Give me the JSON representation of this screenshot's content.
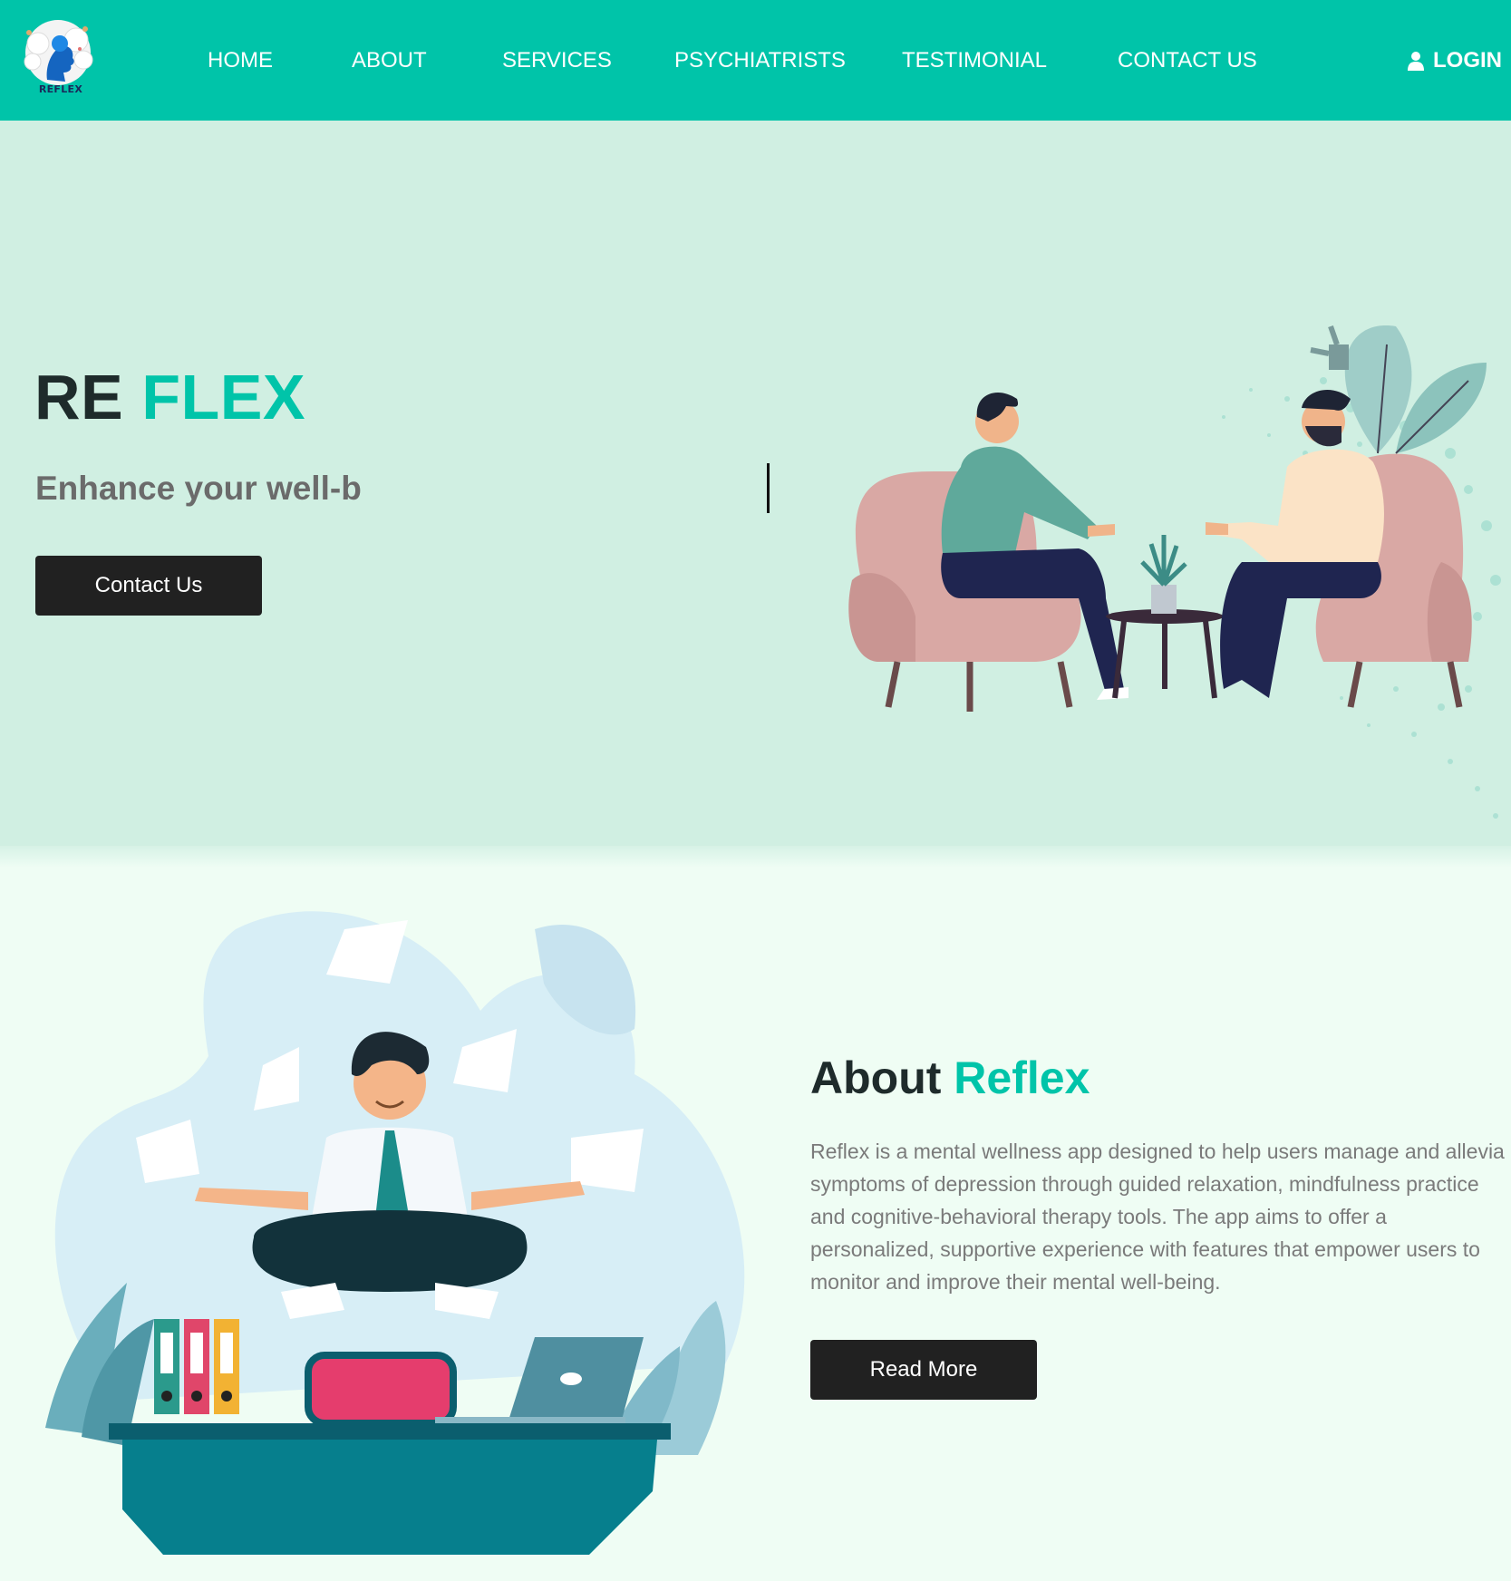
{
  "brand": {
    "logo_text": "REFLEX"
  },
  "nav": {
    "items": [
      "HOME",
      "ABOUT",
      "SERVICES",
      "PSYCHIATRISTS",
      "TESTIMONIAL",
      "CONTACT US"
    ],
    "login_label": "LOGIN",
    "login_icon": "user-icon"
  },
  "hero": {
    "title_part1": "RE",
    "title_part2": "FLEX",
    "subtitle": "Enhance your well-b",
    "button_label": "Contact Us",
    "illustration": "therapy-session-illustration"
  },
  "about": {
    "title_part1": "About",
    "title_part2": "Reflex",
    "body": "Reflex is a mental wellness app designed to help users manage and allevia\nsymptoms of depression through guided relaxation, mindfulness practice\nand cognitive-behavioral therapy tools. The app aims to offer a\npersonalized, supportive experience with features that empower users to\nmonitor and improve their mental well-being.",
    "button_label": "Read More",
    "illustration": "meditation-illustration"
  },
  "colors": {
    "accent": "#00c4a9",
    "hero_bg": "#d0efe2",
    "page_bg": "#effdf4",
    "dark_button": "#212121"
  }
}
